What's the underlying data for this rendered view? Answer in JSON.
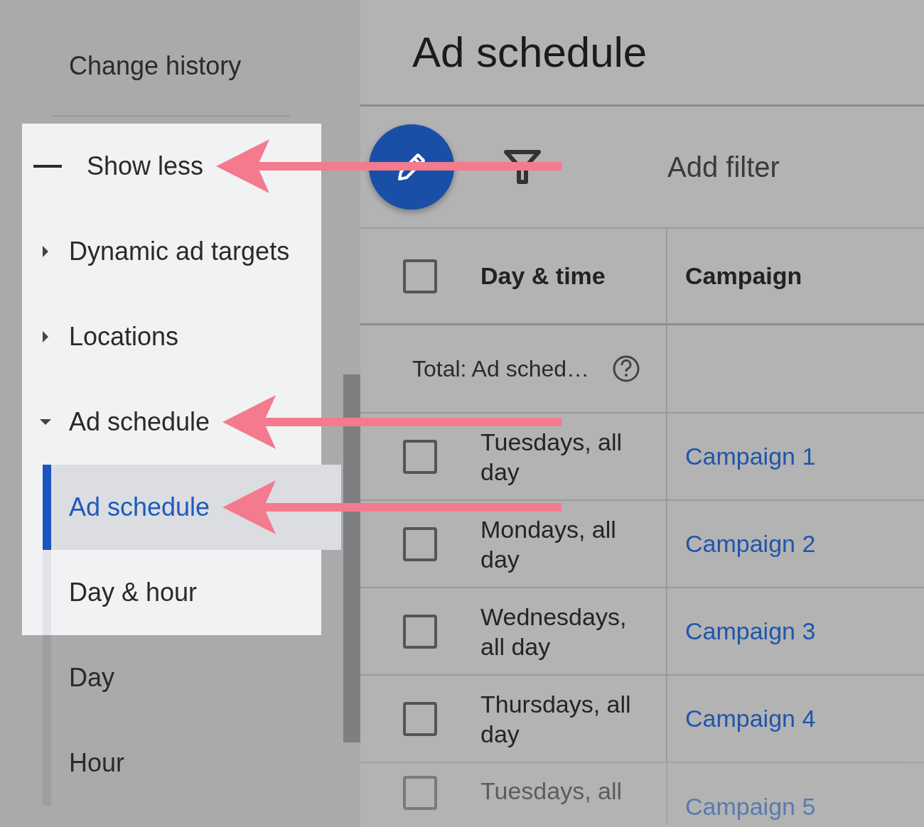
{
  "sidebar": {
    "title": "Change history",
    "items": [
      {
        "kind": "toggle",
        "label": "Show less",
        "highlighted": true,
        "arrow": true
      },
      {
        "kind": "group",
        "label": "Dynamic ad targets",
        "expanded": false,
        "highlighted": true,
        "arrow": false
      },
      {
        "kind": "group",
        "label": "Locations",
        "expanded": false,
        "highlighted": true,
        "arrow": false
      },
      {
        "kind": "group",
        "label": "Ad schedule",
        "expanded": true,
        "highlighted": true,
        "arrow": true,
        "children": [
          {
            "label": "Ad schedule",
            "selected": true,
            "highlighted": true,
            "arrow": true
          },
          {
            "label": "Day & hour",
            "selected": false,
            "highlighted": true,
            "arrow": false
          },
          {
            "label": "Day",
            "selected": false,
            "highlighted": false,
            "arrow": false
          },
          {
            "label": "Hour",
            "selected": false,
            "highlighted": false,
            "arrow": false
          }
        ]
      }
    ]
  },
  "page": {
    "title": "Ad schedule"
  },
  "toolbar": {
    "filter_label": "Add filter"
  },
  "table": {
    "columns": [
      "Day & time",
      "Campaign"
    ],
    "header_checked": false,
    "total": "Total: Ad sched…",
    "rows": [
      {
        "day_time": "Tuesdays, all day",
        "campaign": "Campaign 1",
        "checked": false,
        "faded": false
      },
      {
        "day_time": "Mondays, all day",
        "campaign": "Campaign 2",
        "checked": false,
        "faded": false
      },
      {
        "day_time": "Wednesdays, all day",
        "campaign": "Campaign 3",
        "checked": false,
        "faded": false
      },
      {
        "day_time": "Thursdays, all day",
        "campaign": "Campaign 4",
        "checked": false,
        "faded": false
      },
      {
        "day_time": "Tuesdays, all",
        "campaign": "Campaign 5",
        "checked": false,
        "faded": true
      }
    ]
  }
}
